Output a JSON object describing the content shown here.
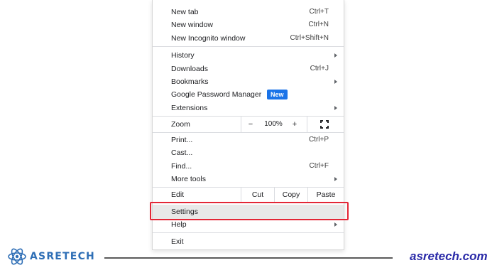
{
  "menu": {
    "new_tab": {
      "label": "New tab",
      "shortcut": "Ctrl+T"
    },
    "new_window": {
      "label": "New window",
      "shortcut": "Ctrl+N"
    },
    "new_incognito": {
      "label": "New Incognito window",
      "shortcut": "Ctrl+Shift+N"
    },
    "history": {
      "label": "History"
    },
    "downloads": {
      "label": "Downloads",
      "shortcut": "Ctrl+J"
    },
    "bookmarks": {
      "label": "Bookmarks"
    },
    "password_manager": {
      "label": "Google Password Manager",
      "badge": "New"
    },
    "extensions": {
      "label": "Extensions"
    },
    "zoom": {
      "label": "Zoom",
      "minus": "−",
      "value": "100%",
      "plus": "+"
    },
    "print": {
      "label": "Print...",
      "shortcut": "Ctrl+P"
    },
    "cast": {
      "label": "Cast..."
    },
    "find": {
      "label": "Find...",
      "shortcut": "Ctrl+F"
    },
    "more_tools": {
      "label": "More tools"
    },
    "edit": {
      "label": "Edit",
      "cut": "Cut",
      "copy": "Copy",
      "paste": "Paste"
    },
    "settings": {
      "label": "Settings"
    },
    "help": {
      "label": "Help"
    },
    "exit": {
      "label": "Exit"
    }
  },
  "footer": {
    "brand": "ASRETECH",
    "site": "asretech.com"
  },
  "colors": {
    "highlight": "#e32636",
    "badge": "#1a73e8",
    "brand": "#2f6fb6",
    "site": "#2a2aa8"
  }
}
